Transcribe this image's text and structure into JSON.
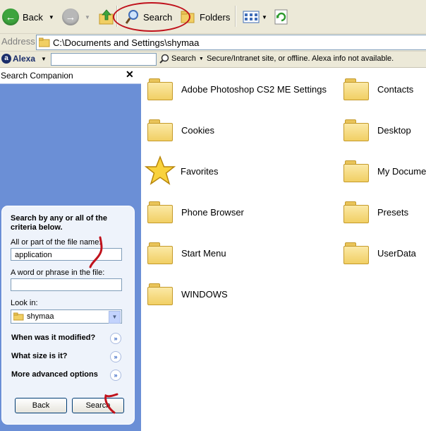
{
  "toolbar": {
    "back_label": "Back",
    "search_label": "Search",
    "folders_label": "Folders"
  },
  "address": {
    "label": "Address",
    "path": "C:\\Documents and Settings\\shymaa"
  },
  "alexa": {
    "brand": "Alexa",
    "search_label": "Search",
    "status": "Secure/Intranet site, or offline. Alexa info not available."
  },
  "search_companion": {
    "title": "Search Companion",
    "heading": "Search by any or all of the criteria below.",
    "filename_label": "All or part of the file name:",
    "filename_value": "application",
    "phrase_label": "A word or phrase in the file:",
    "phrase_value": "",
    "lookin_label": "Look in:",
    "lookin_value": "shymaa",
    "modified_label": "When was it modified?",
    "size_label": "What size is it?",
    "advanced_label": "More advanced options",
    "back_button": "Back",
    "search_button": "Search"
  },
  "items": [
    {
      "label": "Adobe Photoshop CS2 ME Settings",
      "icon": "folder-icon"
    },
    {
      "label": "Contacts",
      "icon": "folder-icon"
    },
    {
      "label": "Cookies",
      "icon": "folder-icon"
    },
    {
      "label": "Desktop",
      "icon": "folder-icon"
    },
    {
      "label": "Favorites",
      "icon": "star-icon"
    },
    {
      "label": "My Documents",
      "icon": "folder-icon"
    },
    {
      "label": "Phone Browser",
      "icon": "folder-icon"
    },
    {
      "label": "Presets",
      "icon": "folder-icon"
    },
    {
      "label": "Start Menu",
      "icon": "folder-icon"
    },
    {
      "label": "UserData",
      "icon": "folder-icon"
    },
    {
      "label": "WINDOWS",
      "icon": "folder-icon"
    }
  ],
  "colors": {
    "accent": "#316ac5",
    "pane": "#6b8fd6",
    "annotation": "#c0121c"
  }
}
